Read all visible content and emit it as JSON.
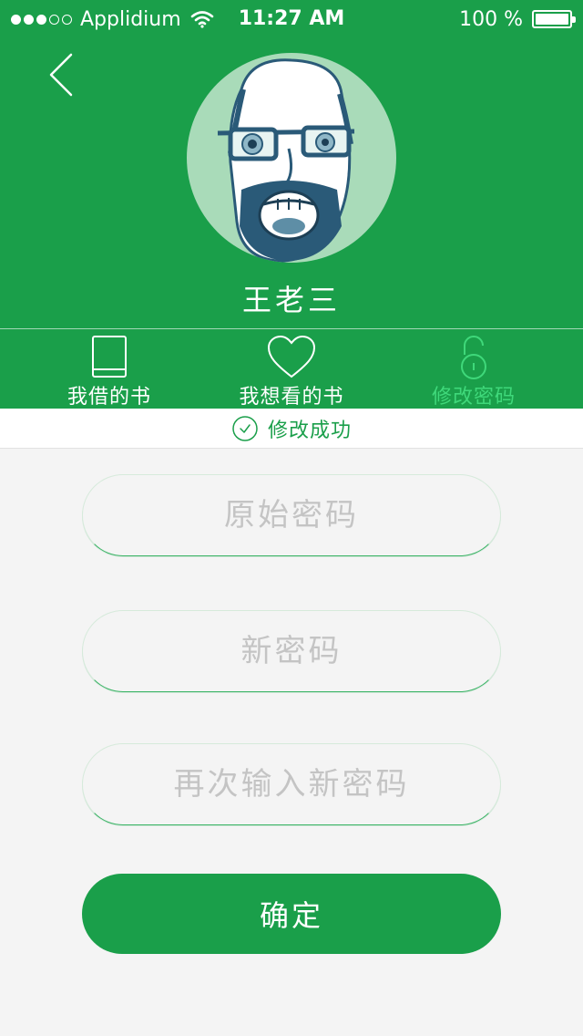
{
  "status_bar": {
    "carrier": "Applidium",
    "time": "11:27 AM",
    "battery": "100 %"
  },
  "profile": {
    "username": "王老三"
  },
  "tabs": [
    {
      "label": "我借的书",
      "icon": "book-icon",
      "active": false
    },
    {
      "label": "我想看的书",
      "icon": "heart-icon",
      "active": false
    },
    {
      "label": "修改密码",
      "icon": "lock-icon",
      "active": true
    }
  ],
  "banner": {
    "text": "修改成功",
    "icon": "check-circle-icon"
  },
  "form": {
    "old_password_placeholder": "原始密码",
    "new_password_placeholder": "新密码",
    "repeat_password_placeholder": "再次输入新密码",
    "confirm_label": "确定"
  },
  "colors": {
    "brand_green": "#1a9f4a",
    "active_tab_green": "#3fd87a",
    "avatar_bg": "#a9dbb9",
    "page_bg": "#f4f4f4"
  }
}
